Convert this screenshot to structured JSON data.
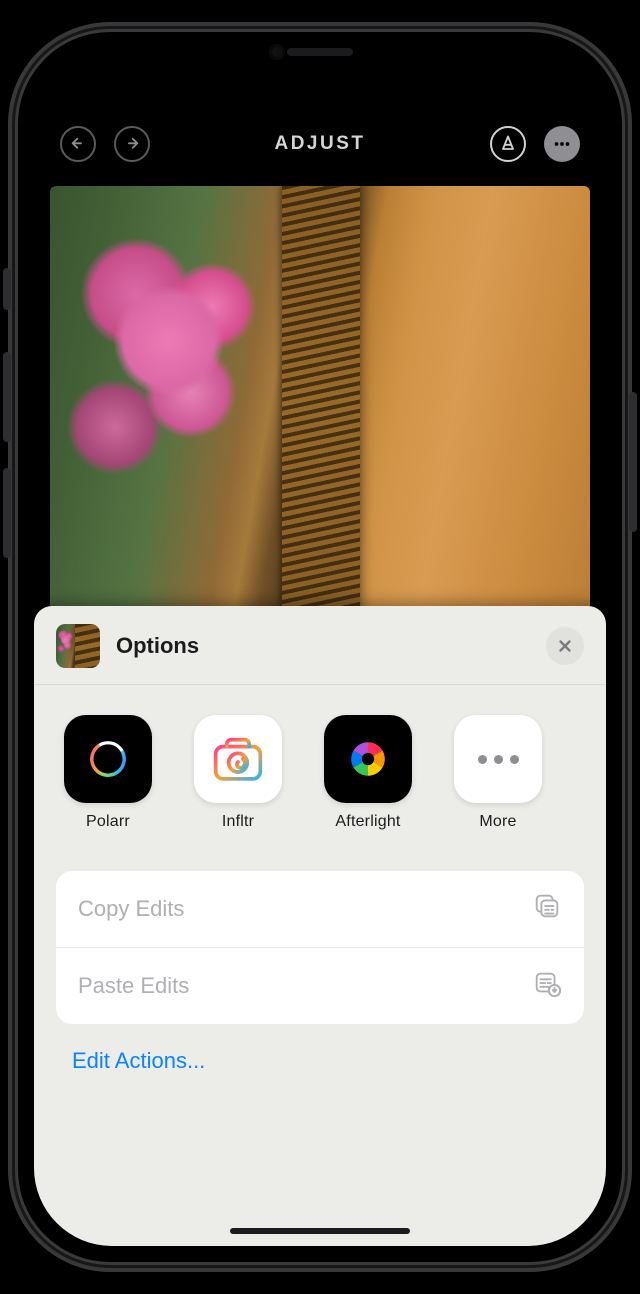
{
  "nav": {
    "title": "ADJUST"
  },
  "sheet": {
    "title": "Options",
    "apps": [
      {
        "name": "Polarr"
      },
      {
        "name": "Infltr"
      },
      {
        "name": "Afterlight"
      },
      {
        "name": "More"
      }
    ],
    "actions": {
      "copy": "Copy Edits",
      "paste": "Paste Edits"
    },
    "editActions": "Edit Actions..."
  }
}
